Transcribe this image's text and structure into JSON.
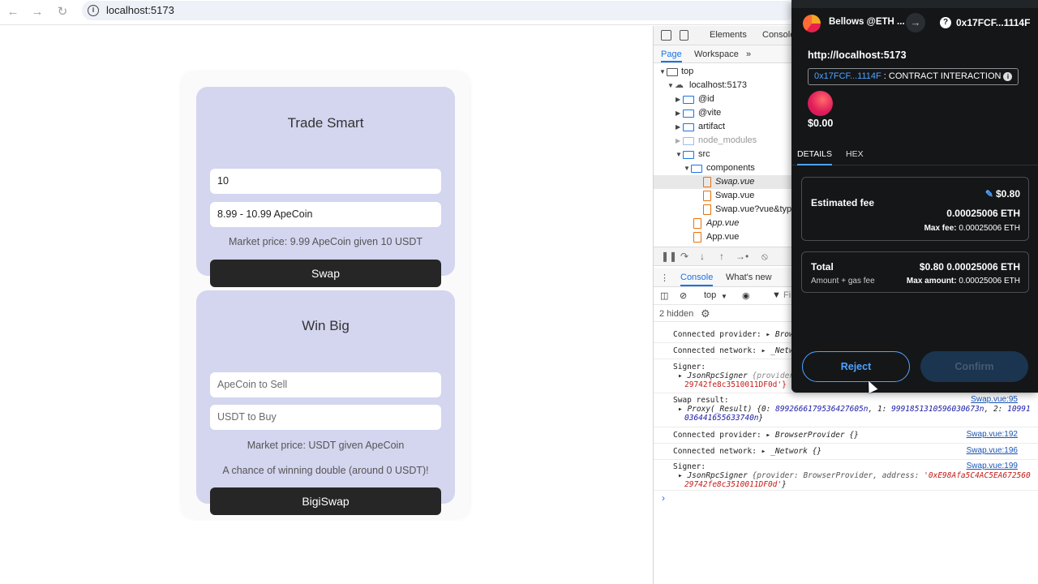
{
  "browser": {
    "url": "localhost:5173",
    "info_icon": "i"
  },
  "app": {
    "swap": {
      "title": "Trade Smart",
      "amount_value": "10",
      "range_value": "8.99 - 10.99 ApeCoin",
      "market_price": "Market price: 9.99 ApeCoin given 10 USDT",
      "button": "Swap"
    },
    "win": {
      "title": "Win Big",
      "sell_placeholder": "ApeCoin to Sell",
      "buy_placeholder": "USDT to Buy",
      "market_price": "Market price: USDT given ApeCoin",
      "chance": "A chance of winning double (around 0 USDT)!",
      "button": "BigiSwap"
    }
  },
  "devtools": {
    "tabs": [
      "Elements",
      "Console"
    ],
    "subtabs": [
      "Page",
      "Workspace"
    ],
    "tree": [
      {
        "label": "top"
      },
      {
        "label": "localhost:5173"
      },
      {
        "label": "@id"
      },
      {
        "label": "@vite"
      },
      {
        "label": "artifact"
      },
      {
        "label": "node_modules"
      },
      {
        "label": "src"
      },
      {
        "label": "components"
      },
      {
        "label": "Swap.vue"
      },
      {
        "label": "Swap.vue"
      },
      {
        "label": "Swap.vue?vue&type"
      },
      {
        "label": "App.vue"
      },
      {
        "label": "App.vue"
      }
    ],
    "console_tabs": [
      "Console",
      "What's new"
    ],
    "context": "top",
    "filter": "Fi",
    "hidden": "2 hidden",
    "logs": {
      "l1": "Connected provider:",
      "l1b": "Brow",
      "l2": "Connected network:",
      "l2b": "_Netw",
      "l3": "Signer:",
      "l3a": "JsonRpcSigner",
      "l3b": "{provider:",
      "l3c": "29742fe8c3510011DF0d'}",
      "l4": "Swap result:",
      "l4src": "Swap.vue:95",
      "l4a": "Proxy(_Result) {0: ",
      "l4n1": "8992666179536427605n",
      "l4m": ", 1: ",
      "l4n2": "9991851310596030673n",
      "l4e": ", 2: ",
      "l4n3": "10991",
      "l4c": "036441655633740n",
      "l4end": "}",
      "l5": "Connected provider:",
      "l5b": "BrowserProvider {}",
      "l5src": "Swap.vue:192",
      "l6": "Connected network:",
      "l6b": "_Network {}",
      "l6src": "Swap.vue:196",
      "l7": "Signer:",
      "l7src": "Swap.vue:199",
      "l7a": "JsonRpcSigner",
      "l7b": "{provider: BrowserProvider, address: ",
      "l7s": "'0xE98Afa5C4AC5EA672560",
      "l7c": "29742fe8c3510011DF0d'",
      "l7end": "}"
    }
  },
  "wallet": {
    "account": "Bellows @ETH ...",
    "address": "0x17FCF...1114F",
    "origin": "http://localhost:5173",
    "contract": "0x17FCF...1114F",
    "contract_suffix": " : CONTRACT INTERACTION",
    "balance": "$0.00",
    "tabs": [
      "DETAILS",
      "HEX"
    ],
    "fee": {
      "label": "Estimated fee",
      "usd": "$0.80",
      "eth": "0.00025006 ETH",
      "max_label": "Max fee:",
      "max_value": "0.00025006 ETH"
    },
    "total": {
      "label": "Total",
      "sub": "Amount + gas fee",
      "value": "$0.80 0.00025006 ETH",
      "max_label": "Max amount:",
      "max_value": "0.00025006 ETH"
    },
    "reject": "Reject",
    "confirm": "Confirm"
  }
}
